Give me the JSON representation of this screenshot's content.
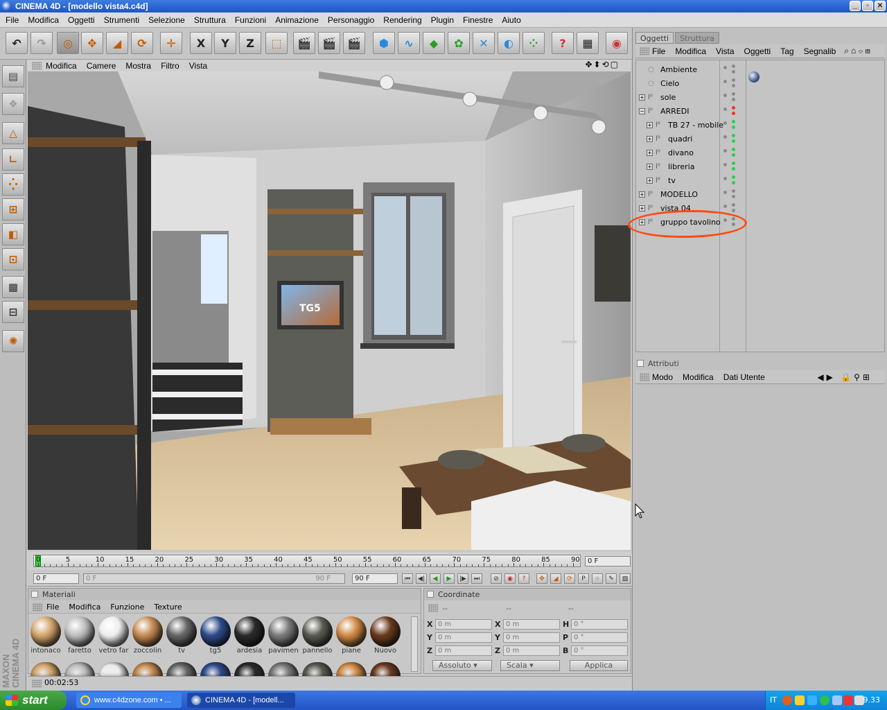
{
  "window": {
    "title": "CINEMA 4D - [modello vista4.c4d]"
  },
  "menubar": [
    "File",
    "Modifica",
    "Oggetti",
    "Strumenti",
    "Selezione",
    "Struttura",
    "Funzioni",
    "Animazione",
    "Personaggio",
    "Rendering",
    "Plugin",
    "Finestre",
    "Aiuto"
  ],
  "toolbar": {
    "axis_x": "X",
    "axis_y": "Y",
    "axis_z": "Z"
  },
  "viewport": {
    "menu": [
      "Modifica",
      "Camere",
      "Mostra",
      "Filtro",
      "Vista"
    ]
  },
  "tv_logo": "TG5",
  "timeline": {
    "ticks": [
      "0",
      "5",
      "10",
      "15",
      "20",
      "25",
      "30",
      "35",
      "40",
      "45",
      "50",
      "55",
      "60",
      "65",
      "70",
      "75",
      "80",
      "85",
      "90"
    ],
    "current_frame": "0 F",
    "start_field": "0 F",
    "range_start": "0 F",
    "range_end": "90 F",
    "end_field": "90 F"
  },
  "materials": {
    "title": "Materiali",
    "menu": [
      "File",
      "Modifica",
      "Funzione",
      "Texture"
    ],
    "items": [
      {
        "label": "intonaco",
        "color": "#d2a56a"
      },
      {
        "label": "faretto",
        "color": "#bdbdbd"
      },
      {
        "label": "vetro far",
        "color": "#eeeeee"
      },
      {
        "label": "zoccolin",
        "color": "#c48a50"
      },
      {
        "label": "tv",
        "color": "#666666"
      },
      {
        "label": "tg5",
        "color": "#2d4a8a"
      },
      {
        "label": "ardesia",
        "color": "#2a2a2a"
      },
      {
        "label": "pavimen",
        "color": "#7a7a7a"
      },
      {
        "label": "pannello",
        "color": "#5a5a52"
      },
      {
        "label": "piane",
        "color": "#d08a45"
      },
      {
        "label": "Nuovo",
        "color": "#6a3a1e"
      }
    ]
  },
  "coordinates": {
    "title": "Coordinate",
    "col_headers": [
      "--",
      "--",
      "--"
    ],
    "rows": [
      {
        "a": "X",
        "av": "0 m",
        "b": "X",
        "bv": "0 m",
        "c": "H",
        "cv": "0 °"
      },
      {
        "a": "Y",
        "av": "0 m",
        "b": "Y",
        "bv": "0 m",
        "c": "P",
        "cv": "0 °"
      },
      {
        "a": "Z",
        "av": "0 m",
        "b": "Z",
        "bv": "0 m",
        "c": "B",
        "cv": "0 °"
      }
    ],
    "mode1": "Assoluto",
    "mode2": "Scala",
    "apply": "Applica"
  },
  "status": {
    "time": "00:02:53"
  },
  "objects_panel": {
    "tabs": [
      "Oggetti",
      "Struttura"
    ],
    "menu": [
      "File",
      "Modifica",
      "Vista",
      "Oggetti",
      "Tag",
      "Segnalib"
    ],
    "items": [
      {
        "name": "Ambiente",
        "depth": 0,
        "expand": "",
        "status": "gray"
      },
      {
        "name": "Cielo",
        "depth": 0,
        "expand": "",
        "status": "gray"
      },
      {
        "name": "sole",
        "depth": 0,
        "expand": "+",
        "status": "gray"
      },
      {
        "name": "ARREDI",
        "depth": 0,
        "expand": "−",
        "status": "red"
      },
      {
        "name": "TB 27 - mobile",
        "depth": 1,
        "expand": "+",
        "status": "green"
      },
      {
        "name": "quadri",
        "depth": 1,
        "expand": "+",
        "status": "green"
      },
      {
        "name": "divano",
        "depth": 1,
        "expand": "+",
        "status": "green"
      },
      {
        "name": "libreria",
        "depth": 1,
        "expand": "+",
        "status": "green"
      },
      {
        "name": "tv",
        "depth": 1,
        "expand": "+",
        "status": "green"
      },
      {
        "name": "MODELLO",
        "depth": 0,
        "expand": "+",
        "status": "gray"
      },
      {
        "name": "vista 04",
        "depth": 0,
        "expand": "+",
        "status": "gray"
      },
      {
        "name": "gruppo tavolino",
        "depth": 0,
        "expand": "+",
        "status": "gray"
      }
    ]
  },
  "attributes_panel": {
    "title": "Attributi",
    "menu": [
      "Modo",
      "Modifica",
      "Dati Utente"
    ]
  },
  "taskbar": {
    "start": "start",
    "tasks": [
      "www.c4dzone.com • ...",
      "CINEMA 4D - [modell..."
    ],
    "lang": "IT",
    "clock": "9.33"
  },
  "colors": {
    "highlight": "#ff4a10",
    "xp_blue": "#2454c4",
    "panel": "#c0c0c0"
  }
}
